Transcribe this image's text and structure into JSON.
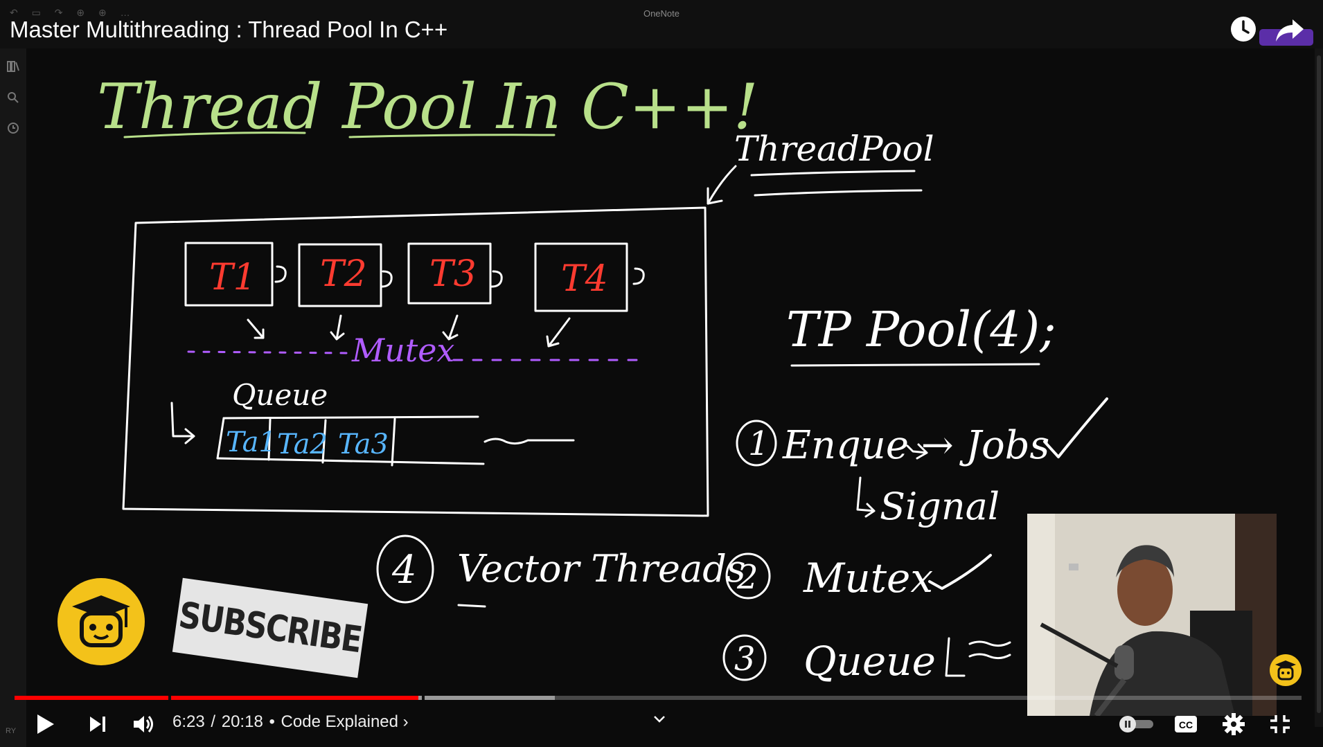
{
  "app": {
    "name": "OneNote"
  },
  "video": {
    "title": "Master Multithreading : Thread Pool In C++",
    "current_time": "6:23",
    "duration": "20:18",
    "chapter": "Code Explained",
    "progress_fraction": 0.314,
    "buffered_fraction": 0.42,
    "subscribe_label": "SUBSCRIBE"
  },
  "whiteboard": {
    "heading": "Thread Pool In C++!",
    "threadpool_label": "ThreadPool",
    "threads": [
      "T1",
      "T2",
      "T3",
      "T4"
    ],
    "mutex_label": "Mutex",
    "queue_label": "Queue",
    "tasks": [
      "Ta1",
      "Ta2",
      "Ta3"
    ],
    "code_line": "TP Pool(4);",
    "steps": [
      {
        "num": "1",
        "text": "Enque → Jobs",
        "sub": "Signal"
      },
      {
        "num": "2",
        "text": "Mutex"
      },
      {
        "num": "3",
        "text": "Queue"
      },
      {
        "num": "4",
        "text": "Vector Threads"
      }
    ]
  },
  "colors": {
    "heading": "#b8e08a",
    "thread_label": "#ff3b30",
    "mutex": "#b05cff",
    "task": "#58b6ff",
    "ink": "#ffffff",
    "progress_played": "#ff0000",
    "brand_yellow": "#f3c21a"
  },
  "icons": {
    "watch_later": "clock-icon",
    "share": "share-arrow-icon",
    "play": "play-icon",
    "next": "next-icon",
    "volume": "volume-icon",
    "chapters": "chevron-down-icon",
    "autoplay": "autoplay-toggle",
    "captions": "cc-icon",
    "settings": "gear-icon",
    "fullscreen": "exit-fullscreen-icon"
  }
}
